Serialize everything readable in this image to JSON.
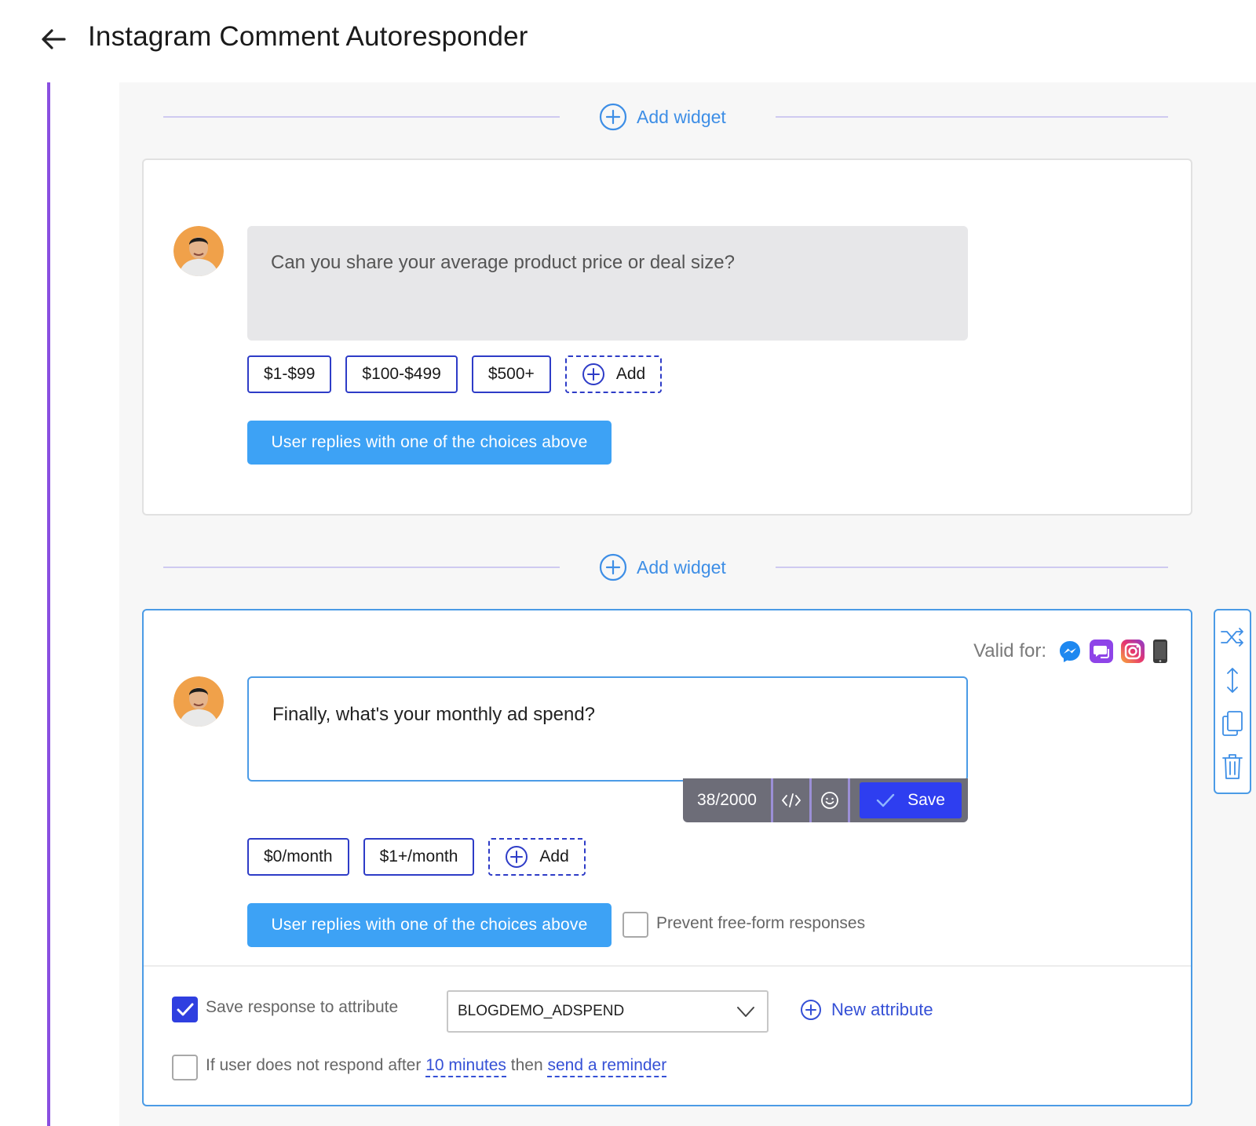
{
  "page": {
    "title": "Instagram Comment Autoresponder"
  },
  "add_widget": {
    "label": "Add widget"
  },
  "card1": {
    "message": "Can you share your average product price or deal size?",
    "choices": [
      "$1-$99",
      "$100-$499",
      "$500+"
    ],
    "add_label": "Add",
    "reply_button": "User replies with one of the choices above"
  },
  "card2": {
    "valid_for_label": "Valid for:",
    "channels": [
      "messenger-icon",
      "sms-chat-icon",
      "instagram-icon",
      "phone-icon"
    ],
    "message": "Finally, what's your monthly ad spend?",
    "toolbar": {
      "char_count": "38/2000",
      "save_label": "Save"
    },
    "choices": [
      "$0/month",
      "$1+/month"
    ],
    "add_label": "Add",
    "reply_button": "User replies with one of the choices above",
    "prevent_freeform": {
      "label": "Prevent free-form responses",
      "checked": false
    },
    "save_attribute": {
      "label": "Save response to attribute",
      "checked": true,
      "value": "BLOGDEMO_ADSPEND"
    },
    "new_attribute_label": "New attribute",
    "reminder": {
      "checked": false,
      "prefix": "If user does not respond after",
      "duration": "10 minutes",
      "middle": "then",
      "action": "send a reminder"
    }
  },
  "colors": {
    "accent_blue": "#3da2f5",
    "primary": "#2e3ef0",
    "timeline_purple": "#8a4fe0"
  }
}
